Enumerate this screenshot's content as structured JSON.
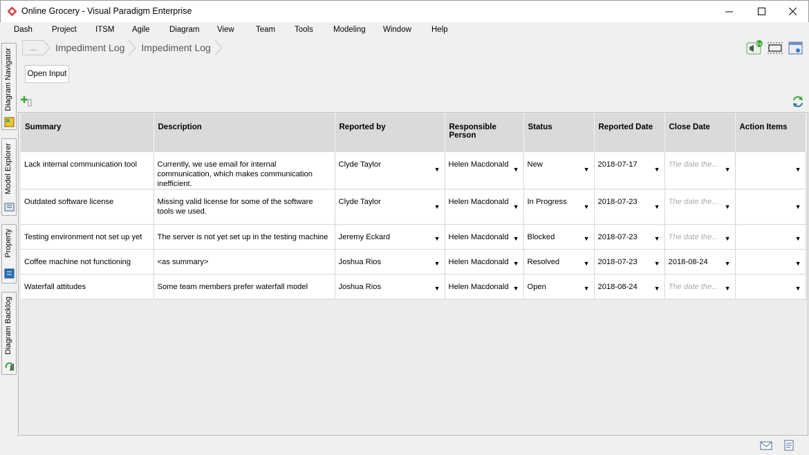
{
  "window": {
    "title": "Online Grocery - Visual Paradigm Enterprise",
    "minimize_glyph": "—",
    "maximize_glyph": "☐",
    "close_glyph": "✕"
  },
  "menu": [
    "Dash",
    "Project",
    "ITSM",
    "Agile",
    "Diagram",
    "View",
    "Team",
    "Tools",
    "Modeling",
    "Window",
    "Help"
  ],
  "side_tabs": [
    "Diagram Navigator",
    "Model Explorer",
    "Property",
    "Diagram Backlog"
  ],
  "breadcrumb": {
    "ellipsis": "...",
    "items": [
      "Impediment Log",
      "Impediment Log"
    ]
  },
  "toolbar": {
    "notification_badge": "9+",
    "icons": [
      "megaphone-icon",
      "fit-page-icon",
      "window-panel-icon"
    ]
  },
  "open_input_label": "Open Input",
  "table": {
    "headers": [
      "Summary",
      "Description",
      "Reported by",
      "Responsible Person",
      "Status",
      "Reported Date",
      "Close Date",
      "Action Items"
    ],
    "placeholder_close_date": "The date the...",
    "rows": [
      {
        "summary": "Lack internal communication tool",
        "description": "Currently, we use email for internal communication, which makes communication inefficient.",
        "reported_by": "Clyde Taylor",
        "responsible": "Helen Macdonald",
        "status": "New",
        "reported_date": "2018-07-17",
        "close_date": "",
        "action_items": ""
      },
      {
        "summary": "Outdated software license",
        "description": "Missing valid license for some of the software tools we used.",
        "reported_by": "Clyde Taylor",
        "responsible": "Helen Macdonald",
        "status": "In Progress",
        "reported_date": "2018-07-23",
        "close_date": "",
        "action_items": ""
      },
      {
        "summary": "Testing environment not set up yet",
        "description": "The server is not yet set up in the testing machine",
        "reported_by": "Jeremy Eckard",
        "responsible": "Helen Macdonald",
        "status": "Blocked",
        "reported_date": "2018-07-23",
        "close_date": "",
        "action_items": ""
      },
      {
        "summary": "Coffee machine not functioning",
        "description": "<as summary>",
        "reported_by": "Joshua Rios",
        "responsible": "Helen Macdonald",
        "status": "Resolved",
        "reported_date": "2018-07-23",
        "close_date": "2018-08-24",
        "action_items": ""
      },
      {
        "summary": "Waterfall attitudes",
        "description": "Some team members prefer waterfall model",
        "reported_by": "Joshua Rios",
        "responsible": "Helen Macdonald",
        "status": "Open",
        "reported_date": "2018-08-24",
        "close_date": "",
        "action_items": ""
      }
    ]
  },
  "colors": {
    "header_bg": "#dadada",
    "grid_line": "#d6d6d6",
    "placeholder_text": "#aaaaaa",
    "app_icon_red": "#d9383a",
    "add_green": "#3aa635"
  },
  "status_icons": [
    "envelope-icon",
    "notes-icon"
  ]
}
